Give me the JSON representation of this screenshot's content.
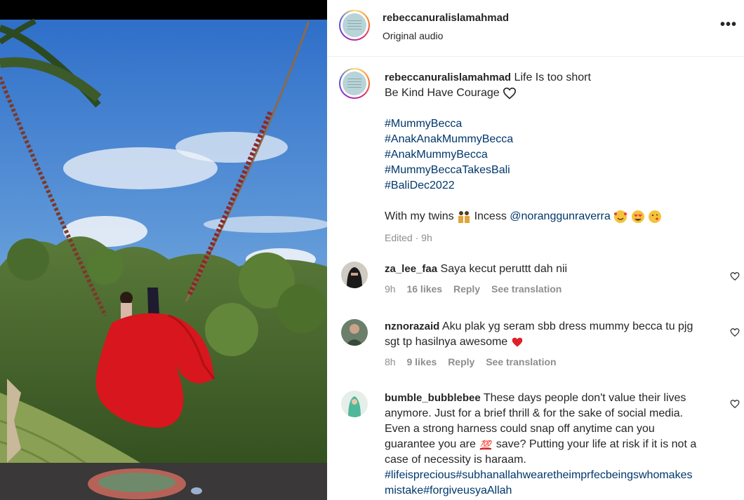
{
  "header": {
    "username": "rebeccanuralislamahmad",
    "audio": "Original audio",
    "more": "..."
  },
  "caption": {
    "username": "rebeccanuralislamahmad",
    "text1": "Life Is too short",
    "text2": "Be Kind Have Courage",
    "hashtags": [
      "#MummyBecca",
      "#AnakAnakMummyBecca",
      "#AnakMummyBecca",
      "#MummyBeccaTakesBali",
      "#BaliDec2022"
    ],
    "twins_text_before": "With my twins",
    "twins_text_after": "Incess",
    "mention": "@noranggunraverra",
    "edited": "Edited",
    "time": "9h"
  },
  "comments": [
    {
      "username": "za_lee_faa",
      "text": "Saya kecut peruttt dah nii",
      "time": "9h",
      "likes": "16 likes",
      "reply": "Reply",
      "translate": "See translation"
    },
    {
      "username": "nznorazaid",
      "text_line1": "Aku plak yg seram sbb dress mummy becca tu pjg",
      "text_line2": "sgt tp hasilnya awesome",
      "time": "8h",
      "likes": "9 likes",
      "reply": "Reply",
      "translate": "See translation"
    },
    {
      "username": "bumble_bubblebee",
      "line1": "These days people don't value their lives",
      "line2": "anymore. Just for a brief thrill & for the sake of social media.",
      "line3": "Even a strong harness could snap off anytime can you",
      "line4a": "guarantee you are",
      "line4b": "save? Putting your life at risk if it is not a",
      "line5": "case of necessity is haraam.",
      "line6": "#lifeisprecious#subhanallahwearetheimprfecbeingswhomakes",
      "line7": "mistake#forgiveusyaAllah"
    }
  ],
  "colors": {
    "link": "#00376b",
    "meta": "#8e8e8e",
    "text": "#262626"
  }
}
